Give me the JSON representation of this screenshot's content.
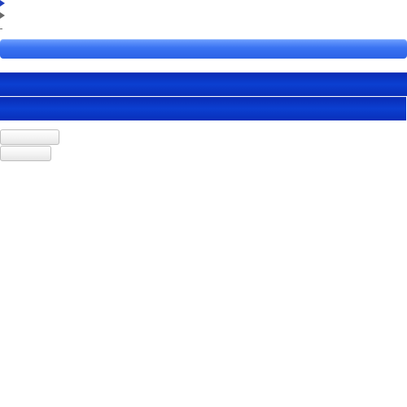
{
  "markers": {
    "first_icon": "triangle-right-icon",
    "second_icon": "triangle-right-icon",
    "third_icon": "dash-icon"
  },
  "colors": {
    "accent_blue": "#2d63e6",
    "dark_blue": "#0a2fb9",
    "button_border": "#bdbdbd"
  },
  "bars": {
    "top_label": "",
    "middle_label": "",
    "lower_label": ""
  },
  "buttons": {
    "first_label": "",
    "second_label": ""
  }
}
